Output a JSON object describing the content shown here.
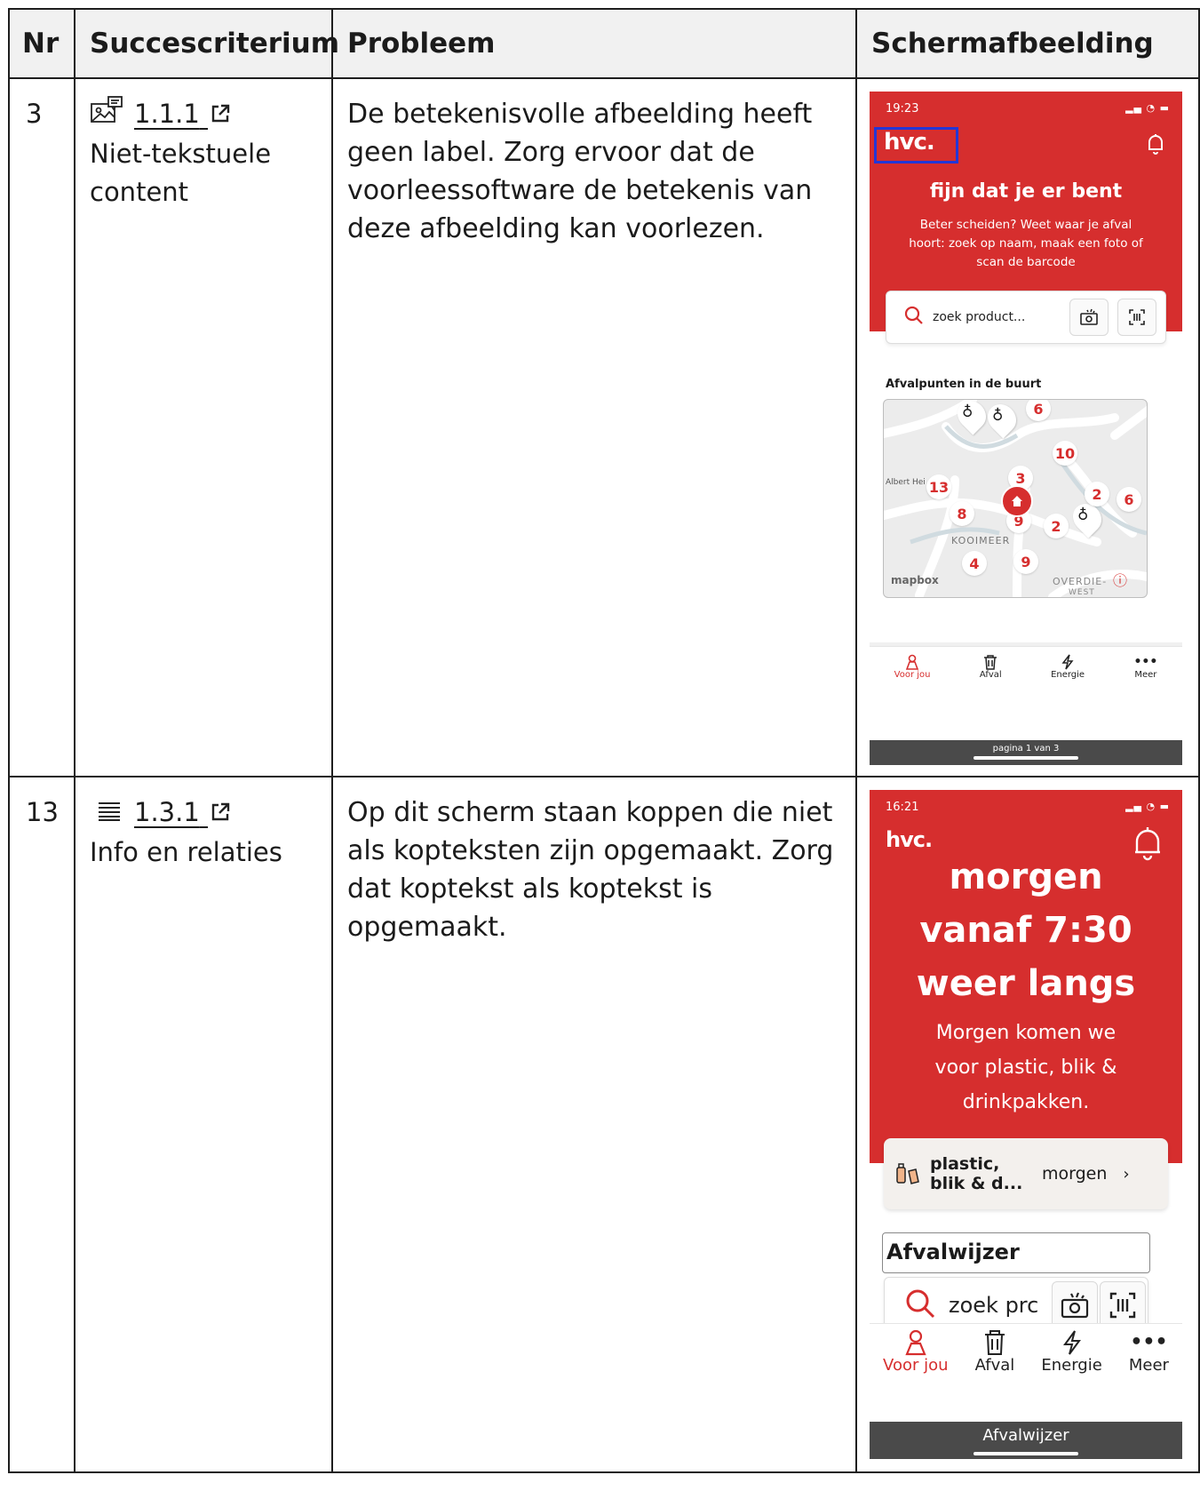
{
  "headers": {
    "nr": "Nr",
    "criterion": "Succescriterium",
    "problem": "Probleem",
    "screenshot": "Schermafbeelding"
  },
  "rows": [
    {
      "nr": "3",
      "criterion_code": "1.1.1",
      "criterion_name": "Niet-tekstuele content",
      "criterion_icon": "image-text-icon",
      "problem": "De betekenisvolle afbeelding heeft geen label. Zorg ervoor dat de voorleessoftware de betekenis van deze afbeelding kan voorlezen."
    },
    {
      "nr": "13",
      "criterion_code": "1.3.1",
      "criterion_name": "Info en relaties",
      "criterion_icon": "list-lines-icon",
      "problem": "Op dit scherm staan koppen die niet als kopteksten zijn opgemaakt. Zorg dat koptekst als koptekst is opgemaakt."
    }
  ],
  "screen1": {
    "time": "19:23",
    "logo": "hvc.",
    "headline": "fijn dat je er bent",
    "intro": "Beter scheiden? Weet waar je afval hoort: zoek op naam, maak een foto of scan de barcode",
    "search_placeholder": "zoek product...",
    "map_title": "Afvalpunten in de buurt",
    "map_labels": {
      "albert": "Albert Hei",
      "kooimeer": "KOOIMEER",
      "overdie": "OVERDIE-",
      "west": "WEST",
      "mapbox": "mapbox"
    },
    "map_numbers": [
      "6",
      "10",
      "13",
      "3",
      "2",
      "6",
      "8",
      "9",
      "2",
      "4",
      "9"
    ],
    "tabs": [
      "Voor jou",
      "Afval",
      "Energie",
      "Meer"
    ],
    "page_indicator": "pagina 1 van 3",
    "accent": "#d62e2e",
    "highlight_color": "#2436d6"
  },
  "screen2": {
    "time": "16:21",
    "logo": "hvc.",
    "headline_line1": "morgen",
    "headline_line2": "vanaf 7:30",
    "headline_line3": "weer langs",
    "subtext_line1": "Morgen komen we",
    "subtext_line2": "voor plastic, blik &",
    "subtext_line3": "drinkpakken.",
    "card_title_line1": "plastic,",
    "card_title_line2": "blik & d...",
    "card_when": "morgen",
    "section_heading": "Afvalwijzer",
    "search_placeholder": "zoek prc",
    "tabs": [
      "Voor jou",
      "Afval",
      "Energie",
      "Meer"
    ],
    "bottom_label": "Afvalwijzer"
  }
}
